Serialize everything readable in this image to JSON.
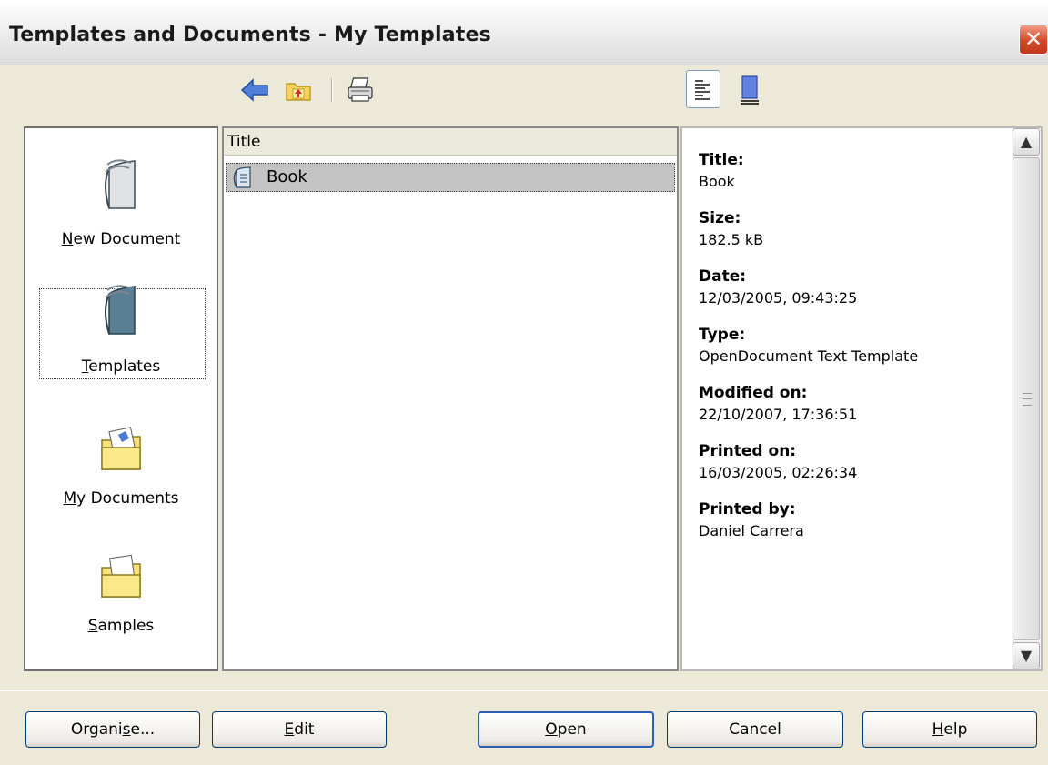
{
  "window": {
    "title": "Templates and Documents - My Templates",
    "close_glyph": "✕"
  },
  "toolbar": {
    "icons": [
      "back-icon",
      "up-one-level-icon",
      "print-icon",
      "document-properties-icon",
      "preview-icon"
    ]
  },
  "nav": {
    "items": [
      {
        "label_prefix": "",
        "label_accel": "N",
        "label_rest": "ew Document",
        "icon": "new-document-icon",
        "selected": false
      },
      {
        "label_prefix": "",
        "label_accel": "T",
        "label_rest": "emplates",
        "icon": "templates-icon",
        "selected": true
      },
      {
        "label_prefix": "",
        "label_accel": "M",
        "label_rest": "y Documents",
        "icon": "my-documents-folder-icon",
        "selected": false
      },
      {
        "label_prefix": "",
        "label_accel": "S",
        "label_rest": "amples",
        "icon": "samples-folder-icon",
        "selected": false
      }
    ]
  },
  "list": {
    "column_header": "Title",
    "rows": [
      {
        "label": "Book",
        "icon": "template-file-icon",
        "selected": true
      }
    ]
  },
  "info": {
    "fields": [
      {
        "key": "Title:",
        "value": "Book"
      },
      {
        "key": "Size:",
        "value": "182.5 kB"
      },
      {
        "key": "Date:",
        "value": "12/03/2005, 09:43:25"
      },
      {
        "key": "Type:",
        "value": "OpenDocument Text Template"
      },
      {
        "key": "Modified on:",
        "value": "22/10/2007, 17:36:51"
      },
      {
        "key": "Printed on:",
        "value": "16/03/2005, 02:26:34"
      },
      {
        "key": "Printed by:",
        "value": "Daniel Carrera"
      }
    ],
    "scroll_up_glyph": "▲",
    "scroll_down_glyph": "▼"
  },
  "buttons": {
    "organise": {
      "prefix": "Organi",
      "accel": "s",
      "rest": "e..."
    },
    "edit": {
      "prefix": "",
      "accel": "E",
      "rest": "dit"
    },
    "open": {
      "prefix": "",
      "accel": "O",
      "rest": "pen"
    },
    "cancel": {
      "prefix": "Cancel",
      "accel": "",
      "rest": ""
    },
    "help": {
      "prefix": "",
      "accel": "H",
      "rest": "elp"
    }
  }
}
